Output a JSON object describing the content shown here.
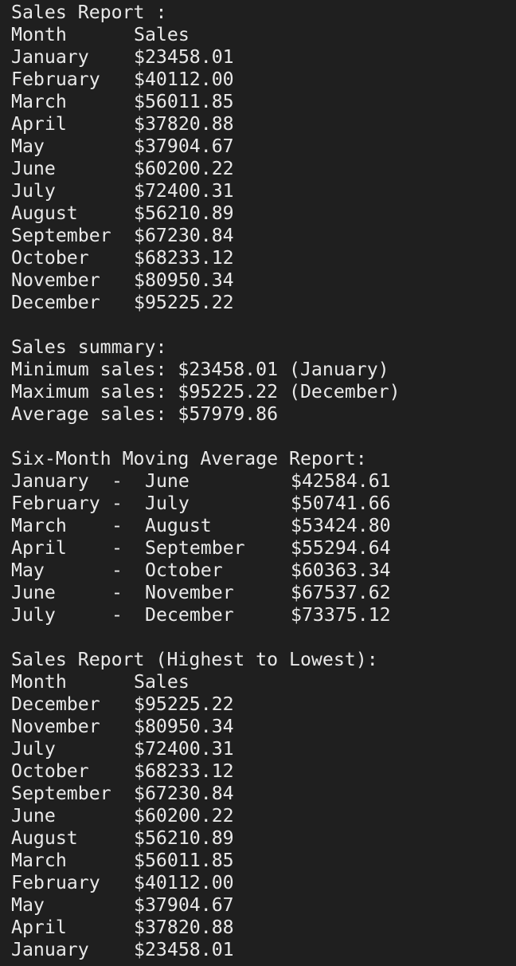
{
  "report": {
    "title": "Sales Report :",
    "header": {
      "month": "Month",
      "sales": "Sales"
    },
    "rows": [
      {
        "month": "January",
        "sales": "$23458.01"
      },
      {
        "month": "February",
        "sales": "$40112.00"
      },
      {
        "month": "March",
        "sales": "$56011.85"
      },
      {
        "month": "April",
        "sales": "$37820.88"
      },
      {
        "month": "May",
        "sales": "$37904.67"
      },
      {
        "month": "June",
        "sales": "$60200.22"
      },
      {
        "month": "July",
        "sales": "$72400.31"
      },
      {
        "month": "August",
        "sales": "$56210.89"
      },
      {
        "month": "September",
        "sales": "$67230.84"
      },
      {
        "month": "October",
        "sales": "$68233.12"
      },
      {
        "month": "November",
        "sales": "$80950.34"
      },
      {
        "month": "December",
        "sales": "$95225.22"
      }
    ]
  },
  "summary": {
    "title": "Sales summary:",
    "min": "Minimum sales: $23458.01 (January)",
    "max": "Maximum sales: $95225.22 (December)",
    "avg": "Average sales: $57979.86"
  },
  "moving_avg": {
    "title": "Six-Month Moving Average Report:",
    "separator": "-",
    "rows": [
      {
        "from": "January",
        "to": "June",
        "value": "$42584.61"
      },
      {
        "from": "February",
        "to": "July",
        "value": "$50741.66"
      },
      {
        "from": "March",
        "to": "August",
        "value": "$53424.80"
      },
      {
        "from": "April",
        "to": "September",
        "value": "$55294.64"
      },
      {
        "from": "May",
        "to": "October",
        "value": "$60363.34"
      },
      {
        "from": "June",
        "to": "November",
        "value": "$67537.62"
      },
      {
        "from": "July",
        "to": "December",
        "value": "$73375.12"
      }
    ]
  },
  "sorted": {
    "title": "Sales Report (Highest to Lowest):",
    "header": {
      "month": "Month",
      "sales": "Sales"
    },
    "rows": [
      {
        "month": "December",
        "sales": "$95225.22"
      },
      {
        "month": "November",
        "sales": "$80950.34"
      },
      {
        "month": "July",
        "sales": "$72400.31"
      },
      {
        "month": "October",
        "sales": "$68233.12"
      },
      {
        "month": "September",
        "sales": "$67230.84"
      },
      {
        "month": "June",
        "sales": "$60200.22"
      },
      {
        "month": "August",
        "sales": "$56210.89"
      },
      {
        "month": "March",
        "sales": "$56011.85"
      },
      {
        "month": "February",
        "sales": "$40112.00"
      },
      {
        "month": "May",
        "sales": "$37904.67"
      },
      {
        "month": "April",
        "sales": "$37820.88"
      },
      {
        "month": "January",
        "sales": "$23458.01"
      }
    ]
  },
  "colors": {
    "background": "#1f1f1f",
    "text": "#e9e9e9",
    "prompt_path": "#5fd7af"
  }
}
